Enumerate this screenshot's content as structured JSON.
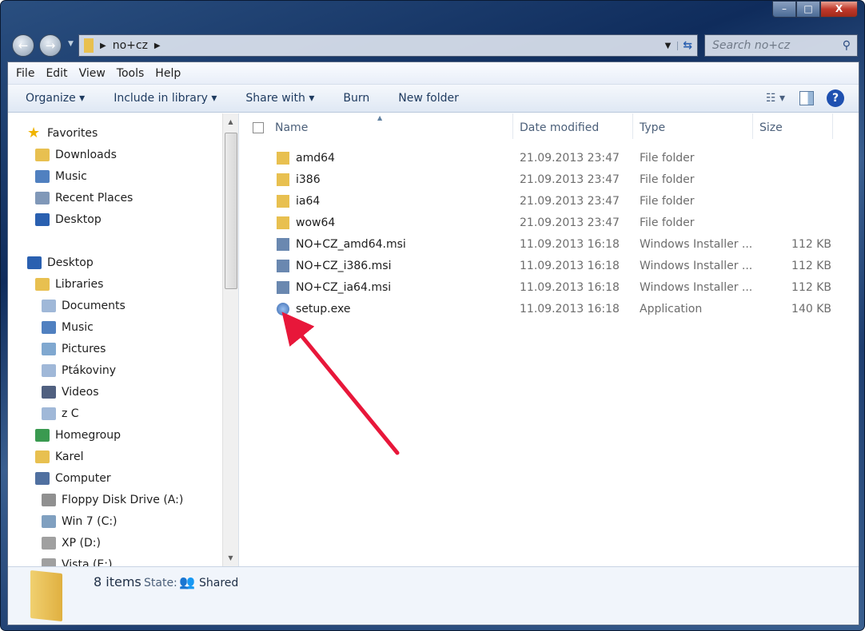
{
  "window": {
    "minimize": "–",
    "maximize": "□",
    "close": "X"
  },
  "address": {
    "path": "no+cz",
    "search_placeholder": "Search no+cz"
  },
  "menu": [
    "File",
    "Edit",
    "View",
    "Tools",
    "Help"
  ],
  "toolbar": {
    "organize": "Organize ▾",
    "include": "Include in library ▾",
    "share": "Share with ▾",
    "burn": "Burn",
    "new_folder": "New folder"
  },
  "nav": [
    {
      "label": "Favorites",
      "level": 0,
      "icon": "star-icon",
      "color": "#f0b400"
    },
    {
      "label": "Downloads",
      "level": 1,
      "icon": "downloads-icon",
      "color": "#e8c050"
    },
    {
      "label": "Music",
      "level": 1,
      "icon": "music-icon",
      "color": "#5080c0"
    },
    {
      "label": "Recent Places",
      "level": 1,
      "icon": "recent-places-icon",
      "color": "#8098b8"
    },
    {
      "label": "Desktop",
      "level": 1,
      "icon": "desktop-icon",
      "color": "#2a60b0"
    },
    {
      "label": "",
      "level": -1
    },
    {
      "label": "Desktop",
      "level": 0,
      "icon": "desktop-icon",
      "color": "#2a60b0"
    },
    {
      "label": "Libraries",
      "level": 1,
      "icon": "libraries-icon",
      "color": "#e8c050"
    },
    {
      "label": "Documents",
      "level": 2,
      "icon": "documents-icon",
      "color": "#a0b8d8"
    },
    {
      "label": "Music",
      "level": 2,
      "icon": "music-icon",
      "color": "#5080c0"
    },
    {
      "label": "Pictures",
      "level": 2,
      "icon": "pictures-icon",
      "color": "#80a8d0"
    },
    {
      "label": "Ptákoviny",
      "level": 2,
      "icon": "library-icon",
      "color": "#a0b8d8"
    },
    {
      "label": "Videos",
      "level": 2,
      "icon": "videos-icon",
      "color": "#506080"
    },
    {
      "label": "z C",
      "level": 2,
      "icon": "library-icon",
      "color": "#a0b8d8"
    },
    {
      "label": "Homegroup",
      "level": 1,
      "icon": "homegroup-icon",
      "color": "#3a9a50"
    },
    {
      "label": "Karel",
      "level": 1,
      "icon": "user-folder-icon",
      "color": "#e8c050"
    },
    {
      "label": "Computer",
      "level": 1,
      "icon": "computer-icon",
      "color": "#5070a0"
    },
    {
      "label": "Floppy Disk Drive (A:)",
      "level": 2,
      "icon": "floppy-icon",
      "color": "#909090"
    },
    {
      "label": "Win 7 (C:)",
      "level": 2,
      "icon": "drive-icon",
      "color": "#80a0c0"
    },
    {
      "label": "XP (D:)",
      "level": 2,
      "icon": "drive-icon",
      "color": "#a0a0a0"
    },
    {
      "label": "Vista (E:)",
      "level": 2,
      "icon": "drive-icon",
      "color": "#a0a0a0"
    }
  ],
  "columns": {
    "name": "Name",
    "date": "Date modified",
    "type": "Type",
    "size": "Size"
  },
  "files": [
    {
      "name": "amd64",
      "date": "21.09.2013 23:47",
      "type": "File folder",
      "size": "",
      "icon": "folder-icon"
    },
    {
      "name": "i386",
      "date": "21.09.2013 23:47",
      "type": "File folder",
      "size": "",
      "icon": "folder-icon"
    },
    {
      "name": "ia64",
      "date": "21.09.2013 23:47",
      "type": "File folder",
      "size": "",
      "icon": "folder-icon"
    },
    {
      "name": "wow64",
      "date": "21.09.2013 23:47",
      "type": "File folder",
      "size": "",
      "icon": "folder-icon"
    },
    {
      "name": "NO+CZ_amd64.msi",
      "date": "11.09.2013 16:18",
      "type": "Windows Installer ...",
      "size": "112 KB",
      "icon": "msi-icon"
    },
    {
      "name": "NO+CZ_i386.msi",
      "date": "11.09.2013 16:18",
      "type": "Windows Installer ...",
      "size": "112 KB",
      "icon": "msi-icon"
    },
    {
      "name": "NO+CZ_ia64.msi",
      "date": "11.09.2013 16:18",
      "type": "Windows Installer ...",
      "size": "112 KB",
      "icon": "msi-icon"
    },
    {
      "name": "setup.exe",
      "date": "11.09.2013 16:18",
      "type": "Application",
      "size": "140 KB",
      "icon": "setup-icon"
    }
  ],
  "status": {
    "count": "8 items",
    "state_label": "State:",
    "state": "Shared"
  },
  "annotation": {
    "arrow_color": "#e8173a"
  }
}
